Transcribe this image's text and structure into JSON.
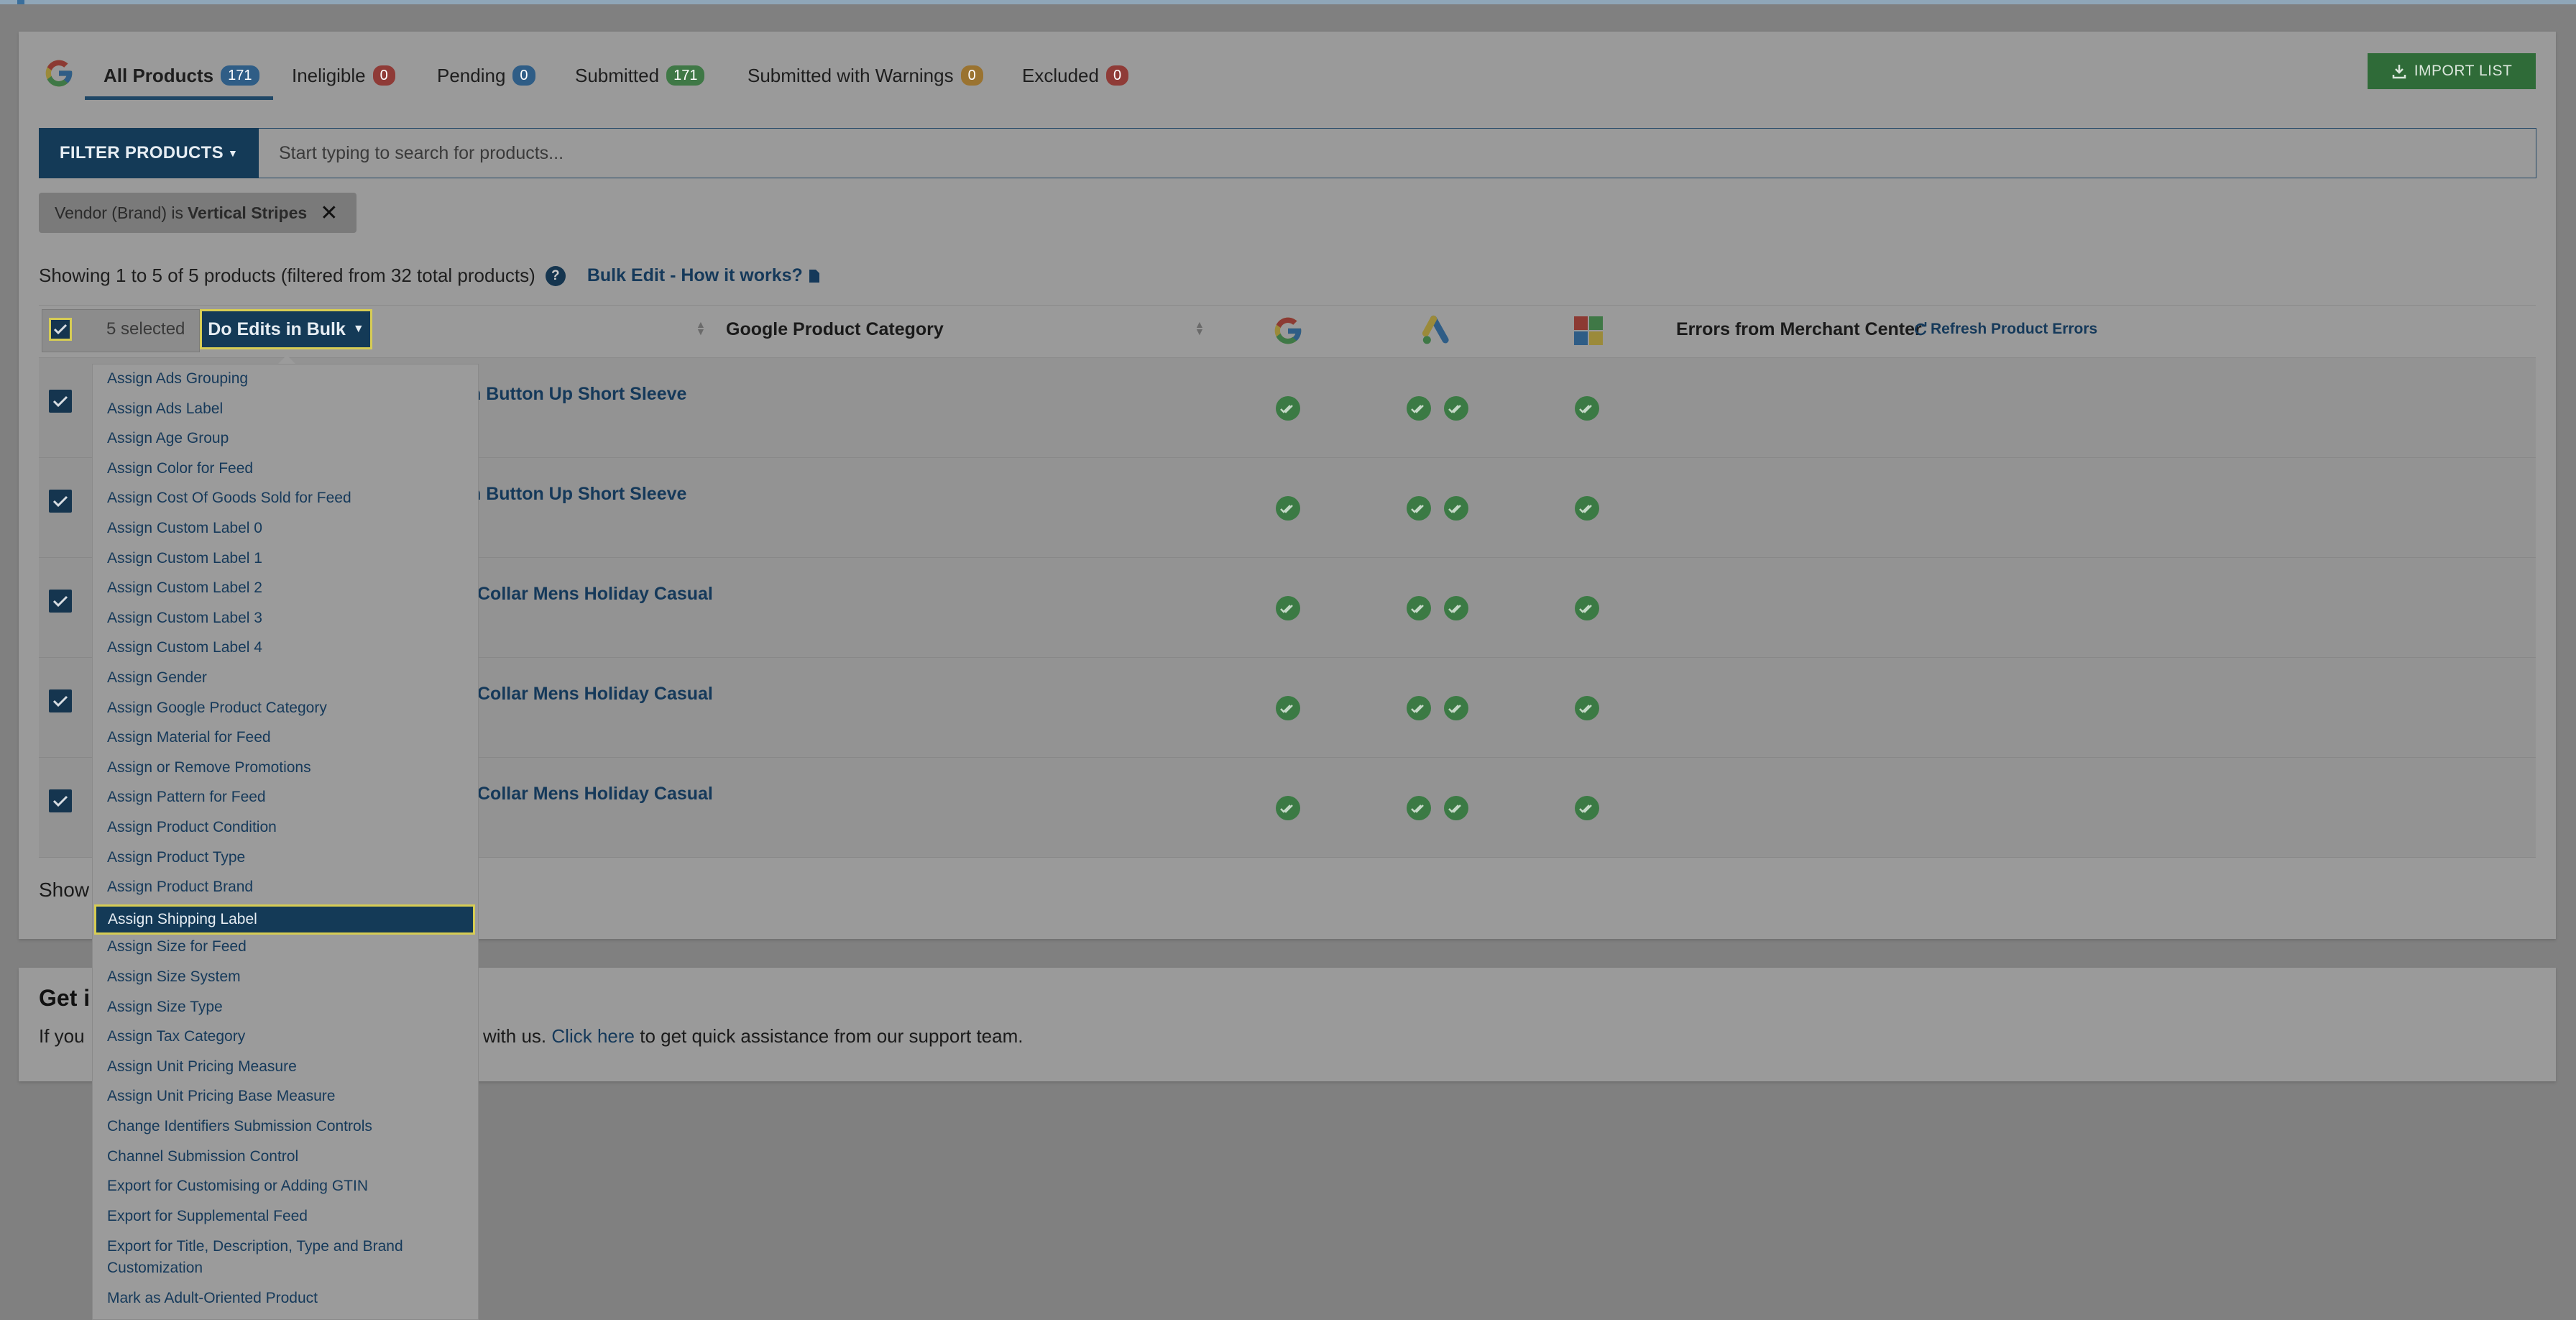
{
  "tabs": [
    {
      "label": "All Products",
      "count": "171"
    },
    {
      "label": "Ineligible",
      "count": "0"
    },
    {
      "label": "Pending",
      "count": "0"
    },
    {
      "label": "Submitted",
      "count": "171"
    },
    {
      "label": "Submitted with Warnings",
      "count": "0"
    },
    {
      "label": "Excluded",
      "count": "0"
    }
  ],
  "import_button": "IMPORT LIST",
  "filter": {
    "button_label": "FILTER PRODUCTS",
    "search_placeholder": "Start typing to search for products...",
    "chip_prefix": "Vendor (Brand) is",
    "chip_value": "Vertical Stripes"
  },
  "showing_text": "Showing 1 to 5 of 5 products (filtered from 32 total products)",
  "bulk_help_link": "Bulk Edit - How it works?",
  "table": {
    "selected_text": "5 selected",
    "bulk_button": "Do Edits in Bulk",
    "col_category": "Google Product Category",
    "col_errors": "Errors from Merchant Center",
    "refresh_label": "Refresh Product Errors",
    "rows": [
      {
        "title": "h Button Up Short Sleeve"
      },
      {
        "title": "h Button Up Short Sleeve"
      },
      {
        "title": "Collar Mens Holiday Casual"
      },
      {
        "title": "Collar Mens Holiday Casual"
      },
      {
        "title": "Collar Mens Holiday Casual"
      }
    ]
  },
  "bottom_show": "Show",
  "help": {
    "title": "Get i",
    "text_start": "If you",
    "text_mid": "with us.",
    "link": "Click here",
    "text_end": "to get quick assistance from our support team."
  },
  "bulk_menu": {
    "items": [
      "Assign Ads Grouping",
      "Assign Ads Label",
      "Assign Age Group",
      "Assign Color for Feed",
      "Assign Cost Of Goods Sold for Feed",
      "Assign Custom Label 0",
      "Assign Custom Label 1",
      "Assign Custom Label 2",
      "Assign Custom Label 3",
      "Assign Custom Label 4",
      "Assign Gender",
      "Assign Google Product Category",
      "Assign Material for Feed",
      "Assign or Remove Promotions",
      "Assign Pattern for Feed",
      "Assign Product Condition",
      "Assign Product Type",
      "Assign Product Brand",
      "Assign Shipping Label",
      "Assign Size for Feed",
      "Assign Size System",
      "Assign Size Type",
      "Assign Tax Category",
      "Assign Unit Pricing Measure",
      "Assign Unit Pricing Base Measure",
      "Change Identifiers Submission Controls",
      "Channel Submission Control",
      "Export for Customising or Adding GTIN",
      "Export for Supplemental Feed",
      "Export for Title, Description, Type and Brand Customization",
      "Mark as Adult-Oriented Product"
    ],
    "selected": "Assign Shipping Label"
  }
}
